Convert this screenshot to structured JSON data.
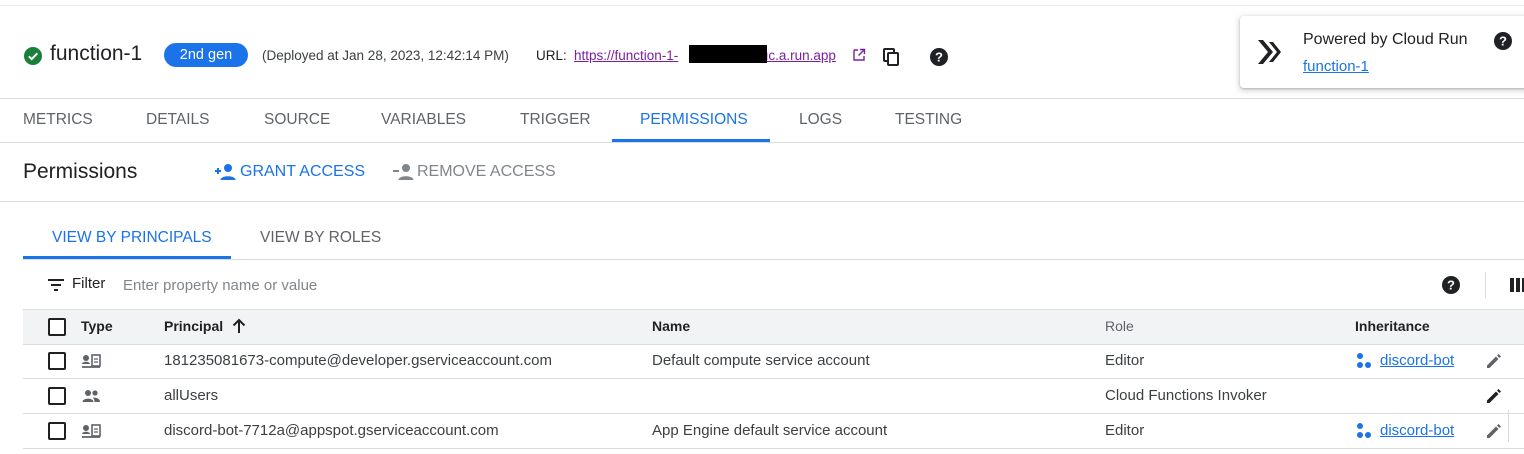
{
  "header": {
    "function_name": "function-1",
    "gen_badge": "2nd gen",
    "deployed": "(Deployed at Jan 28, 2023, 12:42:14 PM)",
    "url_label": "URL:",
    "url_visible_prefix": "https://function-1-",
    "url_visible_suffix": "-uc.a.run.app",
    "icons": [
      "check-circle-icon",
      "open-in-new-icon",
      "copy-icon",
      "help-icon"
    ]
  },
  "cloud_run_card": {
    "title": "Powered by Cloud Run",
    "link": "function-1"
  },
  "tabs": [
    {
      "label": "METRICS"
    },
    {
      "label": "DETAILS"
    },
    {
      "label": "SOURCE"
    },
    {
      "label": "VARIABLES"
    },
    {
      "label": "TRIGGER"
    },
    {
      "label": "PERMISSIONS",
      "active": true
    },
    {
      "label": "LOGS"
    },
    {
      "label": "TESTING"
    }
  ],
  "permissions": {
    "title": "Permissions",
    "grant_access": "GRANT ACCESS",
    "remove_access": "REMOVE ACCESS"
  },
  "view_tabs": [
    {
      "label": "VIEW BY PRINCIPALS",
      "active": true
    },
    {
      "label": "VIEW BY ROLES"
    }
  ],
  "filter": {
    "label": "Filter",
    "placeholder": "Enter property name or value"
  },
  "table": {
    "headers": {
      "type": "Type",
      "principal": "Principal",
      "name": "Name",
      "role": "Role",
      "inheritance": "Inheritance"
    },
    "rows": [
      {
        "type_icon": "service-account-icon",
        "principal": "181235081673-compute@developer.gserviceaccount.com",
        "name": "Default compute service account",
        "role": "Editor",
        "inheritance": "discord-bot"
      },
      {
        "type_icon": "group-icon",
        "principal": "allUsers",
        "name": "",
        "role": "Cloud Functions Invoker",
        "inheritance": ""
      },
      {
        "type_icon": "service-account-icon",
        "principal": "discord-bot-7712a@appspot.gserviceaccount.com",
        "name": "App Engine default service account",
        "role": "Editor",
        "inheritance": "discord-bot"
      }
    ]
  },
  "colors": {
    "accent": "#1a73e8",
    "success": "#188038",
    "visited_link": "#7b1fa2"
  }
}
